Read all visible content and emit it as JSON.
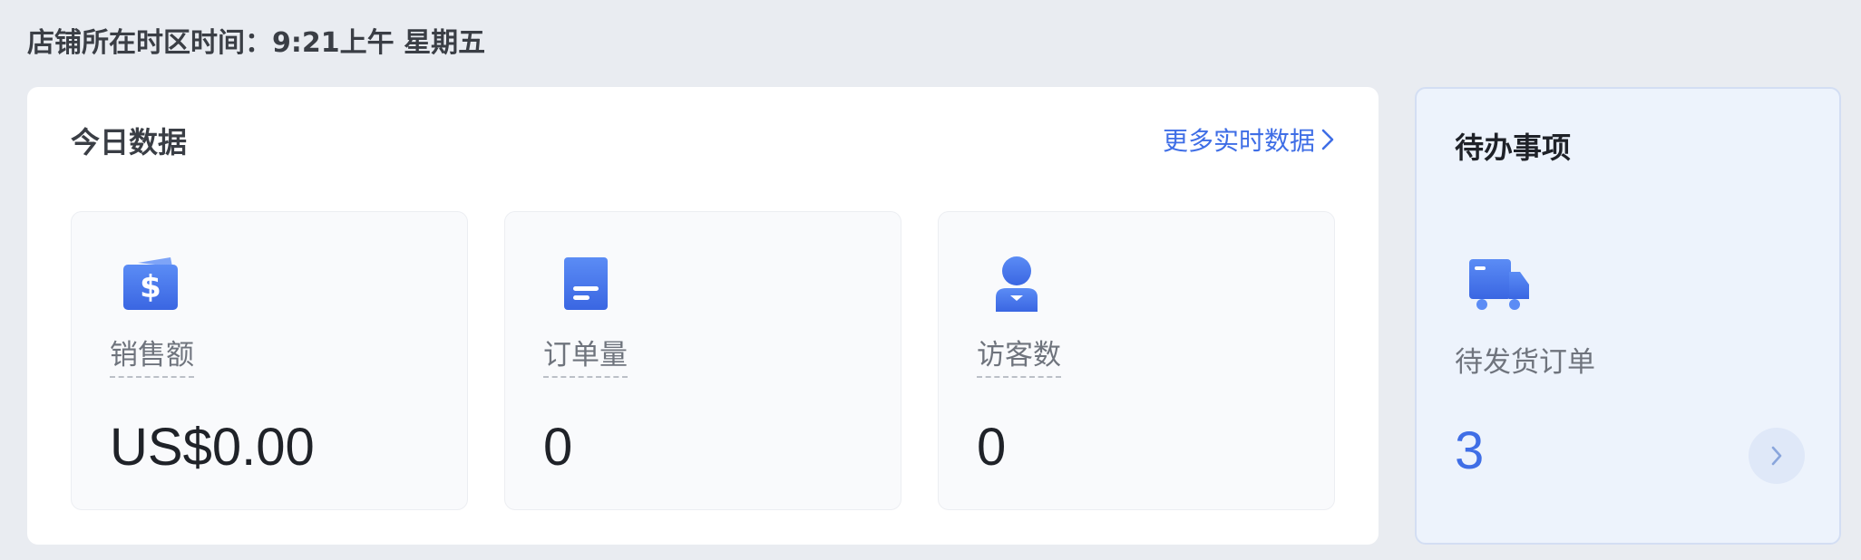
{
  "store_time": {
    "label": "店铺所在时区时间：",
    "time": "9:21上午",
    "weekday": "星期五"
  },
  "today": {
    "title": "今日数据",
    "more_link": "更多实时数据",
    "stats": [
      {
        "label": "销售额",
        "value": "US$0.00",
        "icon": "wallet-icon"
      },
      {
        "label": "订单量",
        "value": "0",
        "icon": "document-icon"
      },
      {
        "label": "访客数",
        "value": "0",
        "icon": "user-icon"
      }
    ]
  },
  "todo": {
    "title": "待办事项",
    "item_label": "待发货订单",
    "item_value": "3",
    "icon": "truck-icon"
  },
  "colors": {
    "accent": "#3f6ee6",
    "background": "#e9ecf1",
    "todo_background": "#edf3fc"
  }
}
